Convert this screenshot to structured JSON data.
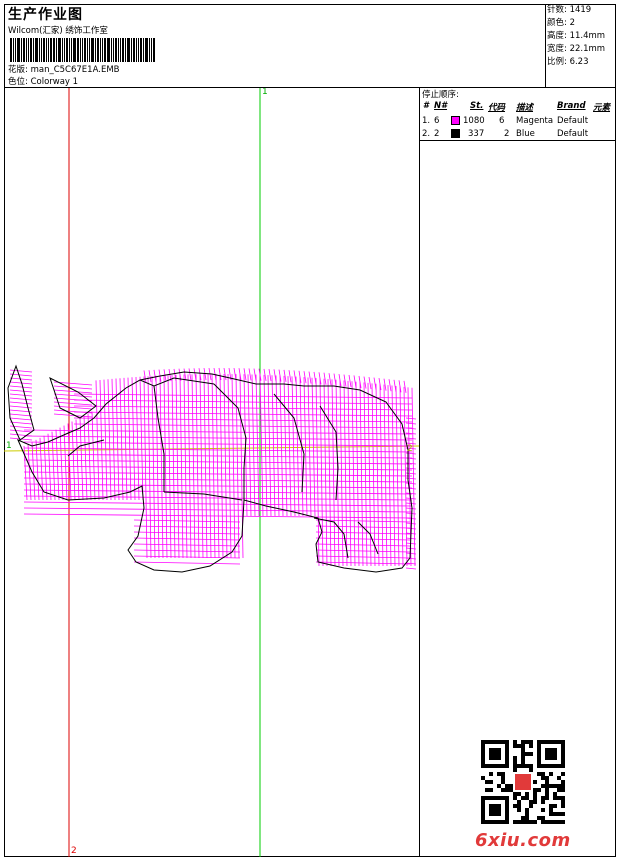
{
  "header": {
    "title": "生产作业图",
    "company": "Wilcom(汇家) 绣饰工作室",
    "design_label": "花版:",
    "design_value": "man_C5C67E1A.EMB",
    "colorway_label": "色位:",
    "colorway_value": "Colorway 1"
  },
  "stats": {
    "stitches": "针数: 1419",
    "colors": "颜色: 2",
    "height": "高度: 11.4mm",
    "width": "宽度: 22.1mm",
    "scale": "比例: 6.23"
  },
  "color_table": {
    "title": "停止顺序:",
    "headers": {
      "seq": "#",
      "n": "N#",
      "st": "St.",
      "code": "代码",
      "desc": "描述",
      "brand": "Brand",
      "elem": "元素"
    },
    "rows": [
      {
        "seq": "1.",
        "n": "6",
        "st": "1080",
        "code": "6",
        "desc": "Magenta",
        "brand": "Default",
        "color": "#ff00ff"
      },
      {
        "seq": "2.",
        "n": "2",
        "st": "337",
        "code": "2",
        "desc": "Blue",
        "brand": "Default",
        "color": "#000000"
      }
    ]
  },
  "guides": {
    "v1_top": "1",
    "v2_bottom": "2",
    "h_left": "1",
    "h_right": "2"
  },
  "colors": {
    "stitch": "#ff00ff",
    "outline": "#000000",
    "guide_green": "#00cc00",
    "guide_red": "#dd0000",
    "guide_yellow": "#cccc00"
  },
  "watermark": "6xiu.com"
}
